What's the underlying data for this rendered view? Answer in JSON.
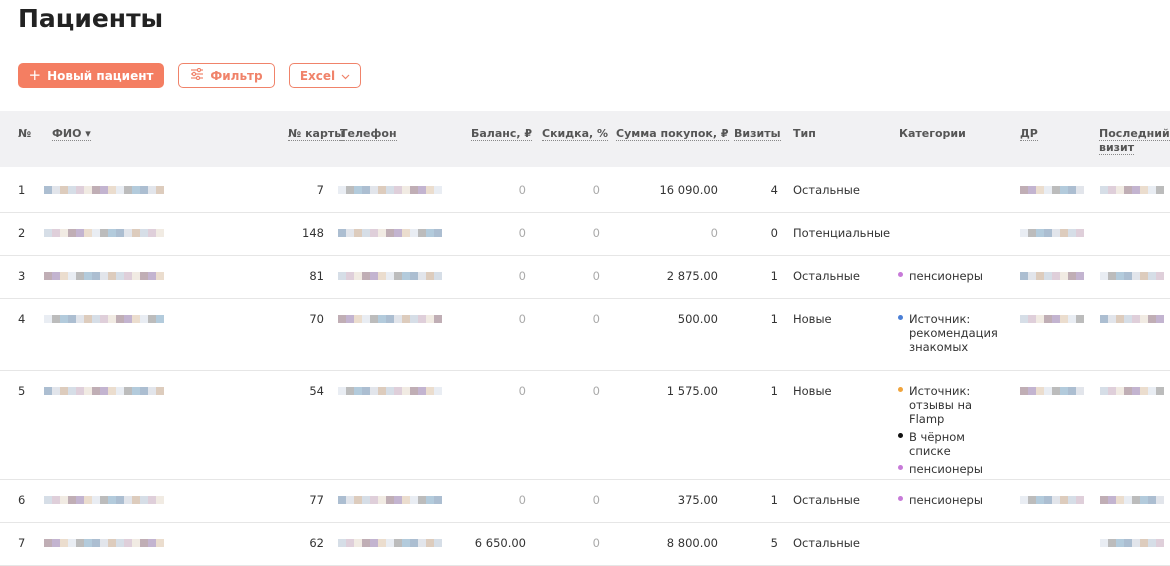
{
  "page": {
    "title": "Пациенты"
  },
  "toolbar": {
    "new_patient": "Новый пациент",
    "filter": "Фильтр",
    "excel": "Excel"
  },
  "colors": {
    "accent": "#f47e62",
    "header_bg": "#f1f1f3"
  },
  "table": {
    "headers": {
      "num": "№",
      "fio": "ФИО ▾",
      "card": "№ карты",
      "phone": "Телефон",
      "balance": "Баланс, ₽",
      "discount": "Скидка, %",
      "purchases": "Сумма покупок, ₽",
      "visits": "Визиты",
      "type": "Тип",
      "categories": "Категории",
      "dob": "ДР",
      "last_visit": "Последний визит"
    },
    "rows": [
      {
        "num": "1",
        "card": "7",
        "balance": "0",
        "discount": "0",
        "purchases": "16 090.00",
        "visits": "4",
        "type": "Остальные",
        "categories": []
      },
      {
        "num": "2",
        "card": "148",
        "balance": "0",
        "discount": "0",
        "purchases": "0",
        "visits": "0",
        "type": "Потенциальные",
        "categories": []
      },
      {
        "num": "3",
        "card": "81",
        "balance": "0",
        "discount": "0",
        "purchases": "2 875.00",
        "visits": "1",
        "type": "Остальные",
        "categories": [
          {
            "label": "пенсионеры",
            "color": "#c77ad8"
          }
        ]
      },
      {
        "num": "4",
        "card": "70",
        "balance": "0",
        "discount": "0",
        "purchases": "500.00",
        "visits": "1",
        "type": "Новые",
        "categories": [
          {
            "label": "Источник: рекомендация знакомых",
            "color": "#4a7fd6"
          }
        ]
      },
      {
        "num": "5",
        "card": "54",
        "balance": "0",
        "discount": "0",
        "purchases": "1 575.00",
        "visits": "1",
        "type": "Новые",
        "categories": [
          {
            "label": "Источник: отзывы на Flamp",
            "color": "#f0a43c"
          },
          {
            "label": "В чёрном списке",
            "color": "#111111"
          },
          {
            "label": "пенсионеры",
            "color": "#c77ad8"
          }
        ]
      },
      {
        "num": "6",
        "card": "77",
        "balance": "0",
        "discount": "0",
        "purchases": "375.00",
        "visits": "1",
        "type": "Остальные",
        "categories": [
          {
            "label": "пенсионеры",
            "color": "#c77ad8"
          }
        ]
      },
      {
        "num": "7",
        "card": "62",
        "balance": "6 650.00",
        "discount": "0",
        "purchases": "8 800.00",
        "visits": "5",
        "type": "Остальные",
        "categories": []
      }
    ]
  }
}
